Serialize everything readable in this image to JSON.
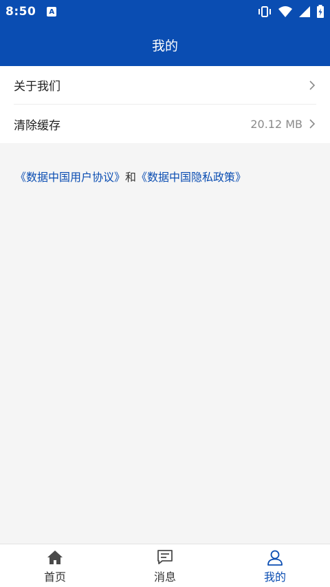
{
  "status_bar": {
    "time": "8:50",
    "app_badge": "A"
  },
  "header": {
    "title": "我的"
  },
  "menu": [
    {
      "label": "关于我们",
      "value": ""
    },
    {
      "label": "清除缓存",
      "value": "20.12 MB"
    }
  ],
  "links": {
    "user_agreement": "《数据中国用户协议》",
    "separator": "和",
    "privacy_policy": "《数据中国隐私政策》"
  },
  "tabs": [
    {
      "label": "首页",
      "icon": "home-icon"
    },
    {
      "label": "消息",
      "icon": "message-icon"
    },
    {
      "label": "我的",
      "icon": "user-icon",
      "active": true
    }
  ],
  "colors": {
    "primary": "#0a4db2",
    "background": "#f5f5f5"
  }
}
